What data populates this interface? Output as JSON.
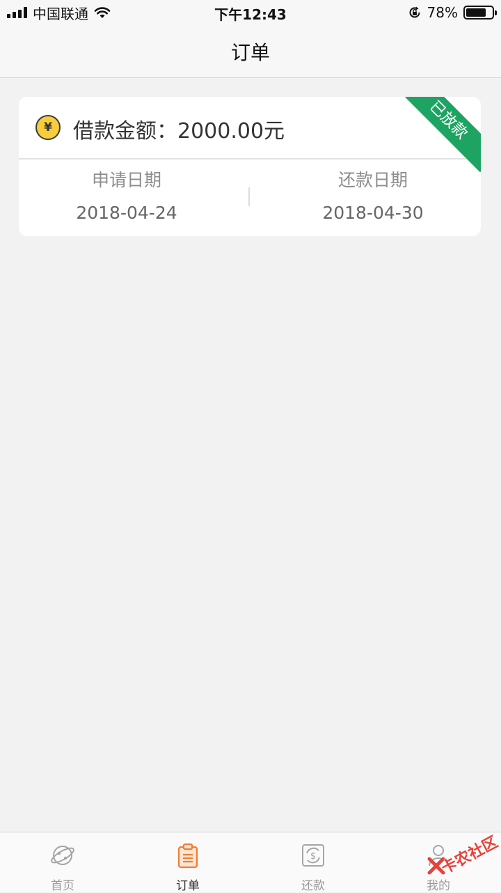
{
  "status_bar": {
    "carrier": "中国联通",
    "time": "下午12:43",
    "battery": "78%",
    "battery_level": 0.78
  },
  "nav": {
    "title": "订单"
  },
  "order": {
    "amount_text": "借款金额：2000.00元",
    "currency_symbol": "¥",
    "status_ribbon": "已放款",
    "apply_date_label": "申请日期",
    "apply_date": "2018-04-24",
    "repay_date_label": "还款日期",
    "repay_date": "2018-04-30"
  },
  "tabs": [
    {
      "label": "首页",
      "icon": "planet-icon",
      "active": false
    },
    {
      "label": "订单",
      "icon": "clipboard-icon",
      "active": true
    },
    {
      "label": "还款",
      "icon": "dollar-refresh-icon",
      "active": false
    },
    {
      "label": "我的",
      "icon": "user-icon",
      "active": false
    }
  ],
  "watermark": "卡农社区",
  "colors": {
    "accent": "#ee7d33",
    "ribbon": "#1ea462",
    "coin": "#f8cd3a",
    "background": "#f2f2f3"
  }
}
